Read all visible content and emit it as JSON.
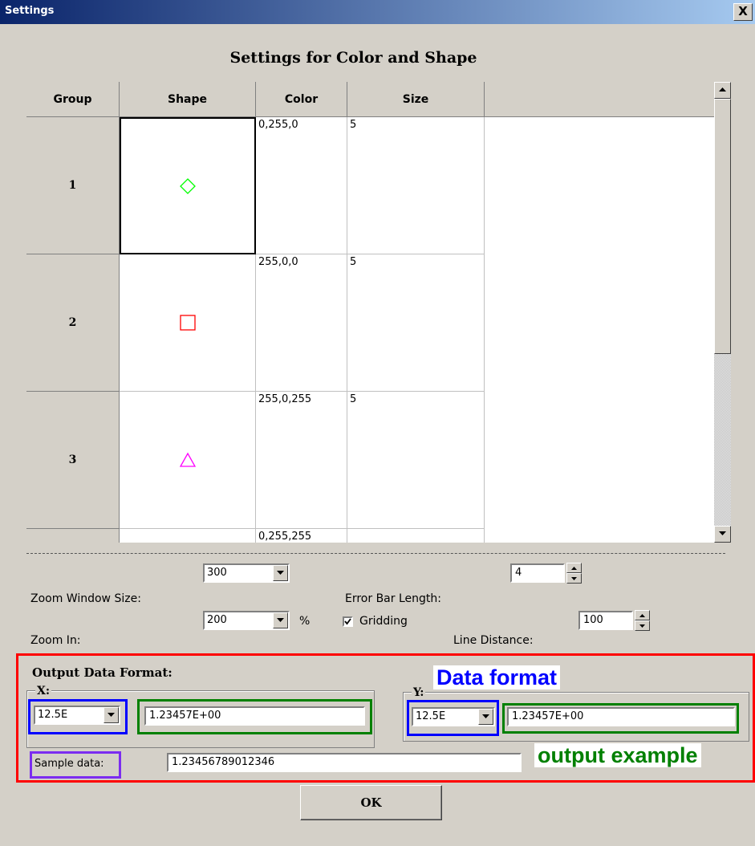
{
  "window": {
    "title": "Settings",
    "close_label": "X"
  },
  "heading": "Settings for Color and Shape",
  "table": {
    "headers": [
      "Group",
      "Shape",
      "Color",
      "Size"
    ],
    "rows": [
      {
        "group": "1",
        "shape": "diamond",
        "shape_color": "#00ff00",
        "color": "0,255,0",
        "size": "5"
      },
      {
        "group": "2",
        "shape": "square",
        "shape_color": "#ff0000",
        "color": "255,0,0",
        "size": "5"
      },
      {
        "group": "3",
        "shape": "triangle",
        "shape_color": "#ff00ff",
        "color": "255,0,255",
        "size": "5"
      },
      {
        "group": "",
        "shape": "",
        "shape_color": "",
        "color": "0,255,255",
        "size": ""
      }
    ]
  },
  "zoom": {
    "window_size_label": "Zoom Window Size:",
    "window_size_value": "300",
    "zoom_in_label": "Zoom In:",
    "zoom_in_value": "200",
    "zoom_in_unit": "%"
  },
  "error_bar": {
    "label": "Error Bar Length:",
    "value": "4"
  },
  "gridding": {
    "label": "Gridding",
    "checked": true
  },
  "line_distance": {
    "label": "Line Distance:",
    "value": "100"
  },
  "output": {
    "title": "Output Data Format:",
    "x": {
      "legend": "X:",
      "format": "12.5E",
      "example": "1.23457E+00"
    },
    "y": {
      "legend": "Y:",
      "format": "12.5E",
      "example": "1.23457E+00"
    },
    "sample_label": "Sample data:",
    "sample_value": "1.23456789012346"
  },
  "annotations": {
    "data_format": "Data format",
    "data_format_color": "#0000ff",
    "output_example": "output example",
    "output_example_color": "#008000"
  },
  "ok_label": "OK"
}
